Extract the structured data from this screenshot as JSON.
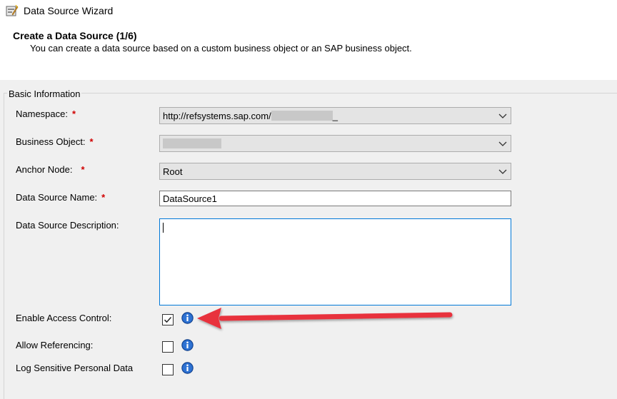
{
  "window": {
    "title": "Data Source Wizard",
    "icon": "wizard-app-icon"
  },
  "header": {
    "title": "Create a Data Source (1/6)",
    "subtitle": "You can create a data source based on a custom business object or an SAP business object."
  },
  "group": {
    "legend": "Basic Information"
  },
  "fields": {
    "namespace": {
      "label": "Namespace:",
      "required": "*",
      "value": "http://refsystems.sap.com/",
      "suffix": "_"
    },
    "business_object": {
      "label": "Business Object:",
      "required": "*",
      "value": ""
    },
    "anchor_node": {
      "label": "Anchor Node:",
      "required": "*",
      "value": "Root"
    },
    "data_source_name": {
      "label": "Data Source Name:",
      "required": "*",
      "value": "DataSource1"
    },
    "data_source_description": {
      "label": "Data Source Description:",
      "value": ""
    },
    "enable_access_control": {
      "label": "Enable Access Control:",
      "checked": true
    },
    "allow_referencing": {
      "label": "Allow Referencing:",
      "checked": false
    },
    "log_sensitive_personal_data": {
      "label": "Log Sensitive Personal Data",
      "checked": false
    }
  },
  "colors": {
    "required": "#d00000",
    "focus_border": "#0078d7",
    "info_icon": "#1f5fbf",
    "annotation_arrow": "#e8313e"
  },
  "icons": [
    "wizard-app-icon",
    "chevron-down-icon",
    "checkmark-icon",
    "info-icon",
    "annotation-arrow"
  ]
}
